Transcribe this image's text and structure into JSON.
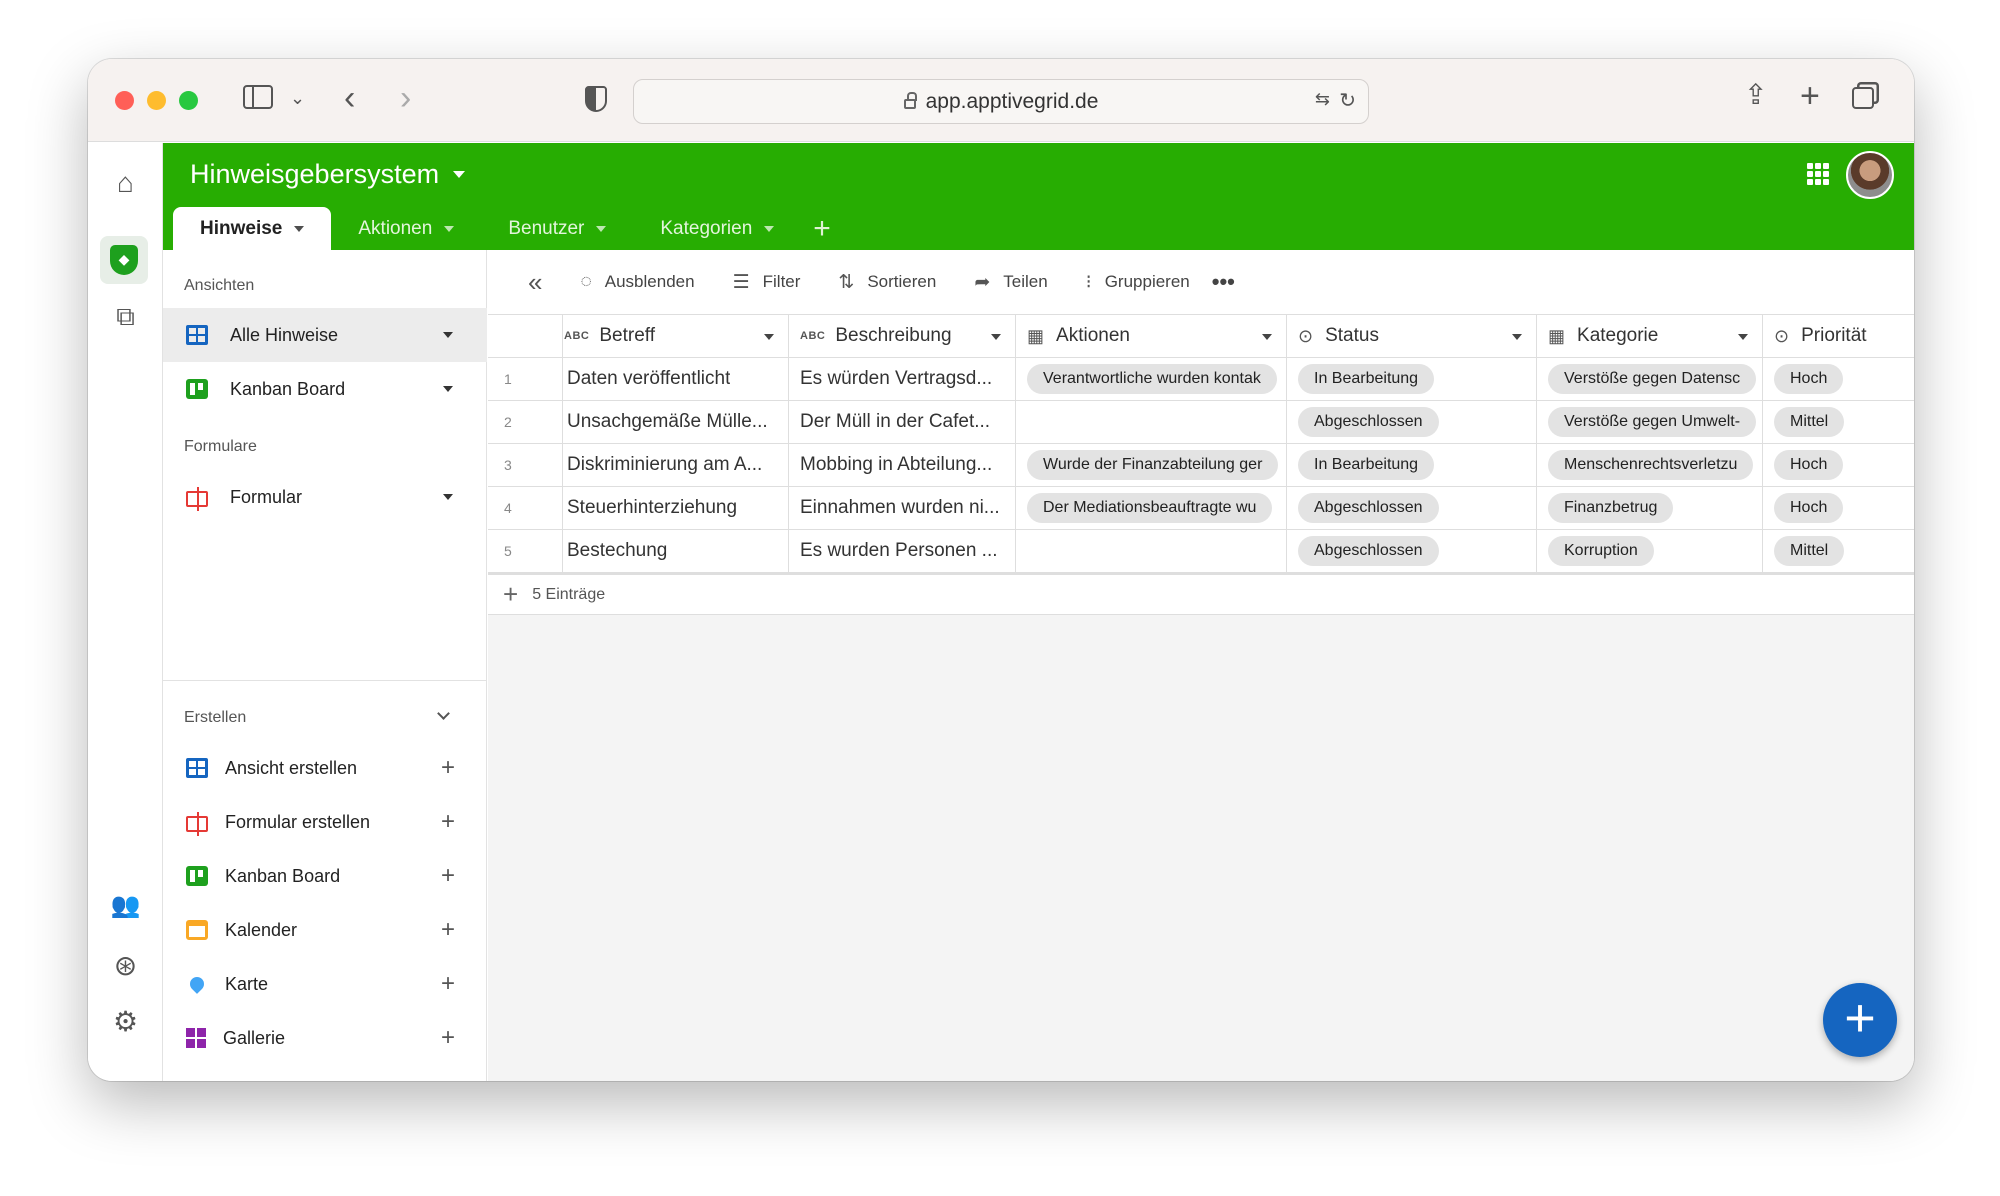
{
  "browser": {
    "url": "app.apptivegrid.de"
  },
  "app": {
    "title": "Hinweisgebersystem"
  },
  "tabs": [
    {
      "label": "Hinweise",
      "active": true
    },
    {
      "label": "Aktionen"
    },
    {
      "label": "Benutzer"
    },
    {
      "label": "Kategorien"
    }
  ],
  "sidebar": {
    "views_heading": "Ansichten",
    "views": [
      {
        "label": "Alle Hinweise",
        "icon": "grid-icon"
      },
      {
        "label": "Kanban Board",
        "icon": "kanban-icon"
      }
    ],
    "forms_heading": "Formulare",
    "forms": [
      {
        "label": "Formular",
        "icon": "form-icon"
      }
    ],
    "create_heading": "Erstellen",
    "create": [
      {
        "label": "Ansicht erstellen",
        "icon": "grid-icon"
      },
      {
        "label": "Formular erstellen",
        "icon": "form-icon"
      },
      {
        "label": "Kanban Board",
        "icon": "kanban-icon"
      },
      {
        "label": "Kalender",
        "icon": "calendar-icon"
      },
      {
        "label": "Karte",
        "icon": "map-pin-icon"
      },
      {
        "label": "Gallerie",
        "icon": "gallery-icon"
      }
    ]
  },
  "toolbar": {
    "hide": "Ausblenden",
    "filter": "Filter",
    "sort": "Sortieren",
    "share": "Teilen",
    "group": "Gruppieren"
  },
  "table": {
    "columns": [
      {
        "type": "ABC",
        "label": "Betreff"
      },
      {
        "type": "ABC",
        "label": "Beschreibung"
      },
      {
        "label": "Aktionen"
      },
      {
        "label": "Status"
      },
      {
        "label": "Kategorie"
      },
      {
        "label": "Priorität"
      }
    ],
    "rows": [
      {
        "n": "1",
        "betreff": "Daten veröffentlicht",
        "beschreibung": "Es würden Vertragsd...",
        "aktionen": "Verantwortliche wurden kontak",
        "status": "In Bearbeitung",
        "kategorie": "Verstöße gegen Datensc",
        "prio": "Hoch"
      },
      {
        "n": "2",
        "betreff": "Unsachgemäße Mülle...",
        "beschreibung": "Der Müll in der Cafet...",
        "aktionen": "",
        "status": "Abgeschlossen",
        "kategorie": "Verstöße gegen Umwelt-",
        "prio": "Mittel"
      },
      {
        "n": "3",
        "betreff": "Diskriminierung am A...",
        "beschreibung": "Mobbing in Abteilung...",
        "aktionen": "Wurde der Finanzabteilung ger",
        "status": "In Bearbeitung",
        "kategorie": "Menschenrechtsverletzu",
        "prio": "Hoch"
      },
      {
        "n": "4",
        "betreff": "Steuerhinterziehung",
        "beschreibung": "Einnahmen wurden ni...",
        "aktionen": "Der Mediationsbeauftragte wu",
        "status": "Abgeschlossen",
        "kategorie": "Finanzbetrug",
        "prio": "Hoch"
      },
      {
        "n": "5",
        "betreff": "Bestechung",
        "beschreibung": "Es wurden Personen ...",
        "aktionen": "",
        "status": "Abgeschlossen",
        "kategorie": "Korruption",
        "prio": "Mittel"
      }
    ],
    "footer": "5 Einträge"
  },
  "colors": {
    "brand": "#27ad02",
    "accent": "#1565c0"
  }
}
